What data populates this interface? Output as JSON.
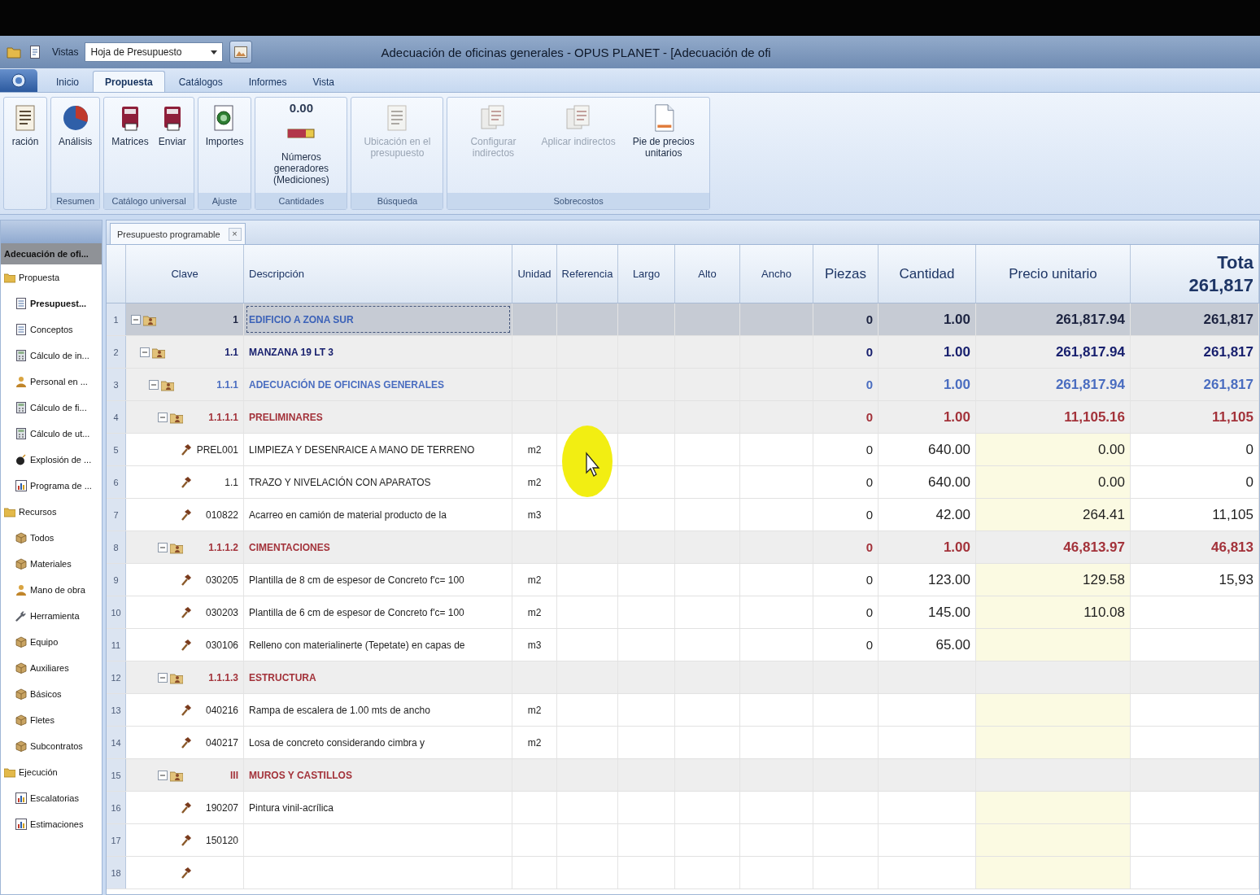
{
  "window": {
    "title": "Adecuación de oficinas generales - OPUS PLANET - [Adecuación de ofi"
  },
  "quick_access": {
    "label": "Vistas",
    "view_select": {
      "value": "Hoja de Presupuesto"
    }
  },
  "ribbon": {
    "tabs": [
      {
        "label": "Inicio",
        "selected": false
      },
      {
        "label": "Propuesta",
        "selected": true
      },
      {
        "label": "Catálogos",
        "selected": false
      },
      {
        "label": "Informes",
        "selected": false
      },
      {
        "label": "Vista",
        "selected": false
      }
    ],
    "groups": [
      {
        "buttons": [
          {
            "label": "ración",
            "kind": "list",
            "disabled": false
          }
        ]
      },
      {
        "label": "Resumen",
        "buttons": [
          {
            "label": "Análisis",
            "kind": "pie",
            "disabled": false
          }
        ]
      },
      {
        "label": "Catálogo universal",
        "buttons": [
          {
            "label": "Matrices",
            "kind": "book",
            "disabled": false
          },
          {
            "label": "Enviar",
            "kind": "book",
            "disabled": false
          }
        ]
      },
      {
        "label": "Ajuste",
        "buttons": [
          {
            "label": "Importes",
            "kind": "coin",
            "disabled": false
          }
        ]
      },
      {
        "label": "Cantidades",
        "buttons": [
          {
            "label": "Números generadores (Mediciones)",
            "kind": "counter",
            "reading": "0.00",
            "disabled": false
          }
        ]
      },
      {
        "label": "Búsqueda",
        "buttons": [
          {
            "label": "Ubicación en el presupuesto",
            "kind": "list",
            "disabled": true
          }
        ]
      },
      {
        "label": "Sobrecostos",
        "buttons": [
          {
            "label": "Configurar indirectos",
            "kind": "docs",
            "disabled": true
          },
          {
            "label": "Aplicar indirectos",
            "kind": "docs",
            "disabled": true
          },
          {
            "label": "Pie de precios unitarios",
            "kind": "page",
            "disabled": false
          }
        ]
      }
    ]
  },
  "sidebar": {
    "project": "Adecuación de ofi...",
    "items": [
      {
        "label": "Propuesta",
        "kind": "folder",
        "selected": false,
        "children": [
          {
            "label": "Presupuest...",
            "kind": "sheet",
            "selected": true
          },
          {
            "label": "Conceptos",
            "kind": "sheet",
            "selected": false
          },
          {
            "label": "Cálculo de in...",
            "kind": "calc",
            "selected": false
          },
          {
            "label": "Personal en ...",
            "kind": "person",
            "selected": false
          },
          {
            "label": "Cálculo de fi...",
            "kind": "calc",
            "selected": false
          },
          {
            "label": "Cálculo de ut...",
            "kind": "calc",
            "selected": false
          },
          {
            "label": "Explosión de ...",
            "kind": "bomb",
            "selected": false
          },
          {
            "label": "Programa de ...",
            "kind": "chart",
            "selected": false
          }
        ]
      },
      {
        "label": "Recursos",
        "kind": "folder",
        "selected": false,
        "children": [
          {
            "label": "Todos",
            "kind": "box",
            "selected": false
          },
          {
            "label": "Materiales",
            "kind": "box",
            "selected": false
          },
          {
            "label": "Mano de obra",
            "kind": "person",
            "selected": false
          },
          {
            "label": "Herramienta",
            "kind": "wrench",
            "selected": false
          },
          {
            "label": "Equipo",
            "kind": "box",
            "selected": false
          },
          {
            "label": "Auxiliares",
            "kind": "box",
            "selected": false
          },
          {
            "label": "Básicos",
            "kind": "box",
            "selected": false
          },
          {
            "label": "Fletes",
            "kind": "box",
            "selected": false
          },
          {
            "label": "Subcontratos",
            "kind": "box",
            "selected": false
          }
        ]
      },
      {
        "label": "Ejecución",
        "kind": "folder",
        "selected": false,
        "children": [
          {
            "label": "Escalatorias",
            "kind": "chart",
            "selected": false
          },
          {
            "label": "Estimaciones",
            "kind": "chart",
            "selected": false
          }
        ]
      }
    ]
  },
  "table": {
    "tab": {
      "label": "Presupuesto programable",
      "close": "×"
    },
    "columns": [
      {
        "label": "Clave"
      },
      {
        "label": "Descripción"
      },
      {
        "label": "Unidad"
      },
      {
        "label": "Referencia"
      },
      {
        "label": "Largo"
      },
      {
        "label": "Alto"
      },
      {
        "label": "Ancho"
      },
      {
        "label": "Piezas"
      },
      {
        "label": "Cantidad"
      },
      {
        "label": "Precio unitario"
      },
      {
        "label": "Tota",
        "value": "261,817"
      }
    ],
    "rows": [
      {
        "number": "1",
        "kind": "group",
        "clave": "1",
        "descripcion": "EDIFICIO A ZONA SUR",
        "piezas": "0",
        "cantidad": "1.00",
        "precio_unitario": "261,817.94",
        "total": "261,817",
        "color": "#1c2340",
        "expanded": true,
        "selected": true,
        "children": [
          {
            "number": "2",
            "kind": "group",
            "clave": "1.1",
            "descripcion": "MANZANA 19 LT 3",
            "piezas": "0",
            "cantidad": "1.00",
            "precio_unitario": "261,817.94",
            "total": "261,817",
            "color": "#18206e",
            "expanded": true,
            "selected": false,
            "children": [
              {
                "number": "3",
                "kind": "group",
                "clave": "1.1.1",
                "descripcion": "ADECUACIÓN DE OFICINAS GENERALES",
                "piezas": "0",
                "cantidad": "1.00",
                "precio_unitario": "261,817.94",
                "total": "261,817",
                "color": "#4a6dc0",
                "expanded": true,
                "selected": false,
                "children": [
                  {
                    "number": "4",
                    "kind": "group",
                    "clave": "1.1.1.1",
                    "descripcion": "PRELIMINARES",
                    "piezas": "0",
                    "cantidad": "1.00",
                    "precio_unitario": "11,105.16",
                    "total": "11,105",
                    "color": "#a3323a",
                    "expanded": true,
                    "selected": false,
                    "children": [
                      {
                        "number": "5",
                        "kind": "concept",
                        "clave": "PREL001",
                        "descripcion": "LIMPIEZA Y DESENRAICE A MANO DE TERRENO",
                        "unidad": "m2",
                        "piezas": "0",
                        "cantidad": "640.00",
                        "precio_unitario": "0.00",
                        "total": "0",
                        "selected": false
                      },
                      {
                        "number": "6",
                        "kind": "concept",
                        "clave": "1.1",
                        "descripcion": "TRAZO Y NIVELACIÓN CON APARATOS",
                        "unidad": "m2",
                        "piezas": "0",
                        "cantidad": "640.00",
                        "precio_unitario": "0.00",
                        "total": "0",
                        "selected": false
                      },
                      {
                        "number": "7",
                        "kind": "concept",
                        "clave": "010822",
                        "descripcion": "Acarreo en camión de material producto de la",
                        "unidad": "m3",
                        "piezas": "0",
                        "cantidad": "42.00",
                        "precio_unitario": "264.41",
                        "total": "11,105",
                        "selected": false
                      }
                    ]
                  },
                  {
                    "number": "8",
                    "kind": "group",
                    "clave": "1.1.1.2",
                    "descripcion": "CIMENTACIONES",
                    "piezas": "0",
                    "cantidad": "1.00",
                    "precio_unitario": "46,813.97",
                    "total": "46,813",
                    "color": "#a3323a",
                    "expanded": true,
                    "selected": false,
                    "children": [
                      {
                        "number": "9",
                        "kind": "concept",
                        "clave": "030205",
                        "descripcion": "Plantilla de 8 cm de espesor de Concreto f'c= 100",
                        "unidad": "m2",
                        "piezas": "0",
                        "cantidad": "123.00",
                        "precio_unitario": "129.58",
                        "total": "15,93",
                        "selected": false
                      },
                      {
                        "number": "10",
                        "kind": "concept",
                        "clave": "030203",
                        "descripcion": "Plantilla de 6 cm de espesor de Concreto f'c= 100",
                        "unidad": "m2",
                        "piezas": "0",
                        "cantidad": "145.00",
                        "precio_unitario": "110.08",
                        "selected": false
                      },
                      {
                        "number": "11",
                        "kind": "concept",
                        "clave": "030106",
                        "descripcion": "Relleno con materialinerte (Tepetate) en capas de",
                        "unidad": "m3",
                        "piezas": "0",
                        "cantidad": "65.00",
                        "selected": false
                      }
                    ]
                  },
                  {
                    "number": "12",
                    "kind": "group",
                    "clave": "1.1.1.3",
                    "descripcion": "ESTRUCTURA",
                    "color": "#a3323a",
                    "expanded": true,
                    "selected": false,
                    "children": [
                      {
                        "number": "13",
                        "kind": "concept",
                        "clave": "040216",
                        "descripcion": "Rampa de escalera de 1.00 mts de ancho",
                        "unidad": "m2",
                        "selected": false
                      },
                      {
                        "number": "14",
                        "kind": "concept",
                        "clave": "040217",
                        "descripcion": "Losa de concreto considerando cimbra y",
                        "unidad": "m2",
                        "selected": false
                      }
                    ]
                  },
                  {
                    "number": "15",
                    "kind": "group",
                    "clave": "III",
                    "descripcion": "MUROS Y CASTILLOS",
                    "color": "#a3323a",
                    "expanded": true,
                    "selected": false,
                    "children": [
                      {
                        "number": "16",
                        "kind": "concept",
                        "clave": "190207",
                        "descripcion": "Pintura vinil-acrílica",
                        "selected": false
                      },
                      {
                        "number": "17",
                        "kind": "concept",
                        "clave": "150120",
                        "selected": false
                      },
                      {
                        "number": "18",
                        "kind": "concept",
                        "selected": false
                      }
                    ]
                  }
                ]
              }
            ]
          }
        ]
      }
    ]
  }
}
